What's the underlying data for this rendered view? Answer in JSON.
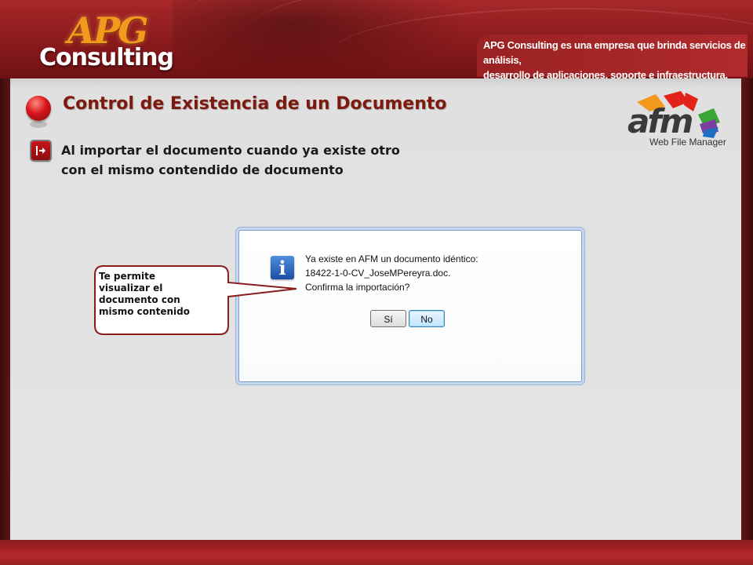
{
  "header": {
    "logo_top": "APG",
    "logo_bottom": "Consulting",
    "tagline_line1": "APG Consulting es una empresa que brinda servicios de análisis,",
    "tagline_line2": "desarrollo de aplicaciones, soporte e infraestructura."
  },
  "main": {
    "title": "Control de Existencia de un Documento",
    "subtitle_line1": "Al importar el documento cuando ya existe otro",
    "subtitle_line2": "con el mismo contendido de documento"
  },
  "afm_logo": {
    "word": "afm",
    "caption": "Web File Manager"
  },
  "dialog": {
    "icon": "info-icon",
    "message_line1": "Ya existe en AFM un documento idéntico:",
    "message_line2": "18422-1-0-CV_JoseMPereyra.doc.",
    "message_line3": "Confirma la importación?",
    "yes_label": "Sí",
    "no_label": "No"
  },
  "callout": {
    "line1": "Te permite",
    "line2": "visualizar el",
    "line3": "documento con",
    "line4": "mismo contenido"
  },
  "colors": {
    "brand_red": "#a8282a",
    "title_color": "#7d1a10",
    "callout_border": "#8a1c1e",
    "logo_orange": "#f39a1e"
  }
}
